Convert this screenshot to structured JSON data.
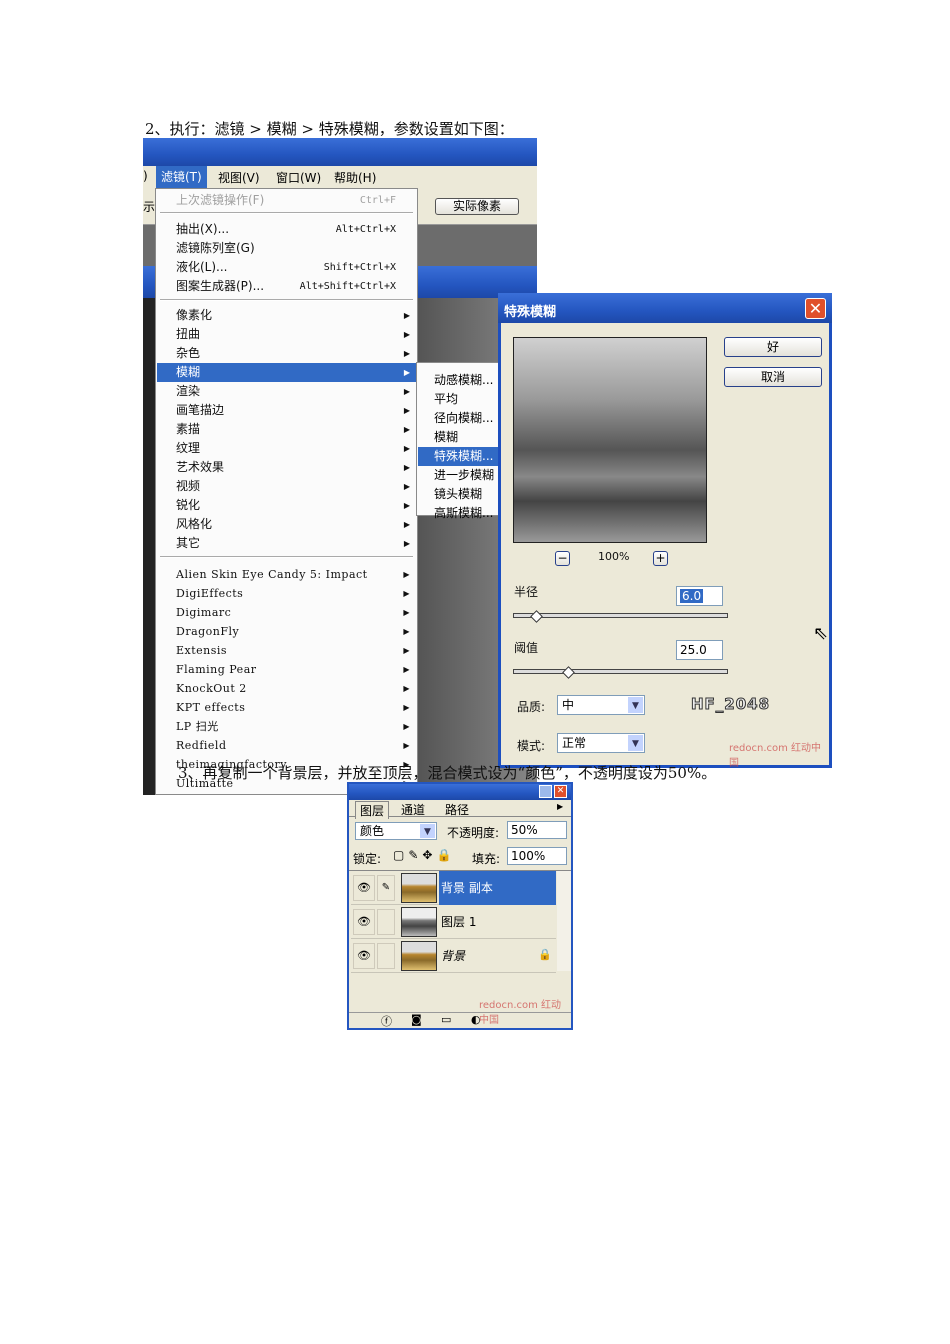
{
  "step2": "2、执行：滤镜 > 模糊 > 特殊模糊，参数设置如下图：",
  "step3": "3、再复制一个背景层，并放至顶层，混合模式设为“颜色”，不透明度设为50%。",
  "menubar": {
    "filter": "滤镜(T)",
    "view": "视图(V)",
    "window": "窗口(W)",
    "help": "帮助(H)",
    "cut_left": ")",
    "cut_left2": "示"
  },
  "toolbar": {
    "actual_pixels": "实际像素"
  },
  "filter_menu": {
    "last_filter": {
      "label": "上次滤镜操作(F)",
      "shortcut": "Ctrl+F"
    },
    "group1": [
      {
        "label": "抽出(X)...",
        "shortcut": "Alt+Ctrl+X"
      },
      {
        "label": "滤镜陈列室(G)",
        "shortcut": ""
      },
      {
        "label": "液化(L)...",
        "shortcut": "Shift+Ctrl+X"
      },
      {
        "label": "图案生成器(P)...",
        "shortcut": "Alt+Shift+Ctrl+X"
      }
    ],
    "group2": [
      "像素化",
      "扭曲",
      "杂色",
      "模糊",
      "渲染",
      "画笔描边",
      "素描",
      "纹理",
      "艺术效果",
      "视频",
      "锐化",
      "风格化",
      "其它"
    ],
    "group3": [
      "Alien Skin Eye Candy 5: Impact",
      "DigiEffects",
      "Digimarc",
      "DragonFly",
      "Extensis",
      "Flaming Pear",
      "KnockOut 2",
      "KPT effects",
      "LP 扫光",
      "Redfield",
      "theimagingfactory",
      "Ultimatte"
    ],
    "highlighted": "模糊"
  },
  "blur_submenu": {
    "items": [
      "动感模糊...",
      "平均",
      "径向模糊...",
      "模糊",
      "特殊模糊...",
      "进一步模糊",
      "镜头模糊",
      "高斯模糊..."
    ],
    "highlighted": "特殊模糊..."
  },
  "dialog": {
    "title": "特殊模糊",
    "ok": "好",
    "cancel": "取消",
    "zoom": "100%",
    "zoom_out": "−",
    "zoom_in": "+",
    "radius_label": "半径",
    "radius": "6.0",
    "radius_fraction": 0.06,
    "threshold_label": "阈值",
    "threshold": "25.0",
    "threshold_fraction": 0.25,
    "quality_label": "品质:",
    "quality": "中",
    "mode_label": "模式:",
    "mode": "正常",
    "brand": "HF_2048",
    "watermark": "redocn.com 红动中国"
  },
  "layers_panel": {
    "tabs": [
      "图层",
      "通道",
      "路径"
    ],
    "blend_mode": "颜色",
    "opacity_label": "不透明度:",
    "opacity": "50%",
    "lock_label": "锁定:",
    "fill_label": "填充:",
    "fill": "100%",
    "layers": [
      {
        "name": "背景 副本",
        "selected": true
      },
      {
        "name": "图层 1",
        "selected": false
      },
      {
        "name": "背景",
        "selected": false
      }
    ],
    "watermark": "redocn.com 红动中国"
  }
}
